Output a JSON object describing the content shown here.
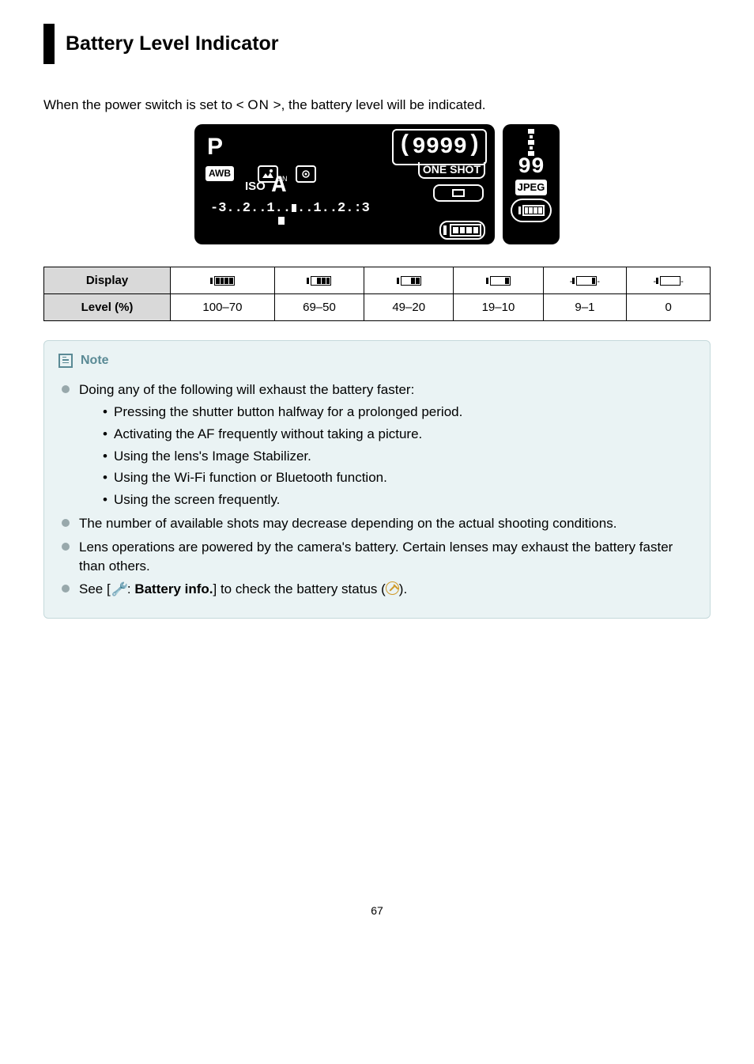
{
  "heading": "Battery Level Indicator",
  "intro_before": "When the power switch is set to < ",
  "intro_on": "ON",
  "intro_after": " >, the battery level will be indicated.",
  "diagram": {
    "mode": "P",
    "awb": "AWB",
    "iso": "ISO",
    "auto": "A",
    "shots": "9999",
    "oneshot": "ONE SHOT",
    "exposure": "-3..2..1..",
    "exposure_mid": "..1..2.:3",
    "side_num": "99",
    "jpeg": "JPEG"
  },
  "table": {
    "row1_label": "Display",
    "row2_label": "Level (%)",
    "levels": [
      "100–70",
      "69–50",
      "49–20",
      "19–10",
      "9–1",
      "0"
    ],
    "segs": [
      4,
      3,
      2,
      1,
      1,
      0
    ],
    "flash": [
      false,
      false,
      false,
      false,
      true,
      true
    ]
  },
  "note": {
    "title": "Note",
    "b1": "Doing any of the following will exhaust the battery faster:",
    "s1": "Pressing the shutter button halfway for a prolonged period.",
    "s2": "Activating the AF frequently without taking a picture.",
    "s3": "Using the lens's Image Stabilizer.",
    "s4": "Using the Wi-Fi function or Bluetooth function.",
    "s5": "Using the screen frequently.",
    "b2": "The number of available shots may decrease depending on the actual shooting conditions.",
    "b3": "Lens operations are powered by the camera's battery. Certain lenses may exhaust the battery faster than others.",
    "b4_a": "See [",
    "b4_bold": "Battery info.",
    "b4_b": "] to check the battery status (",
    "b4_c": ")."
  },
  "pagenum": "67"
}
